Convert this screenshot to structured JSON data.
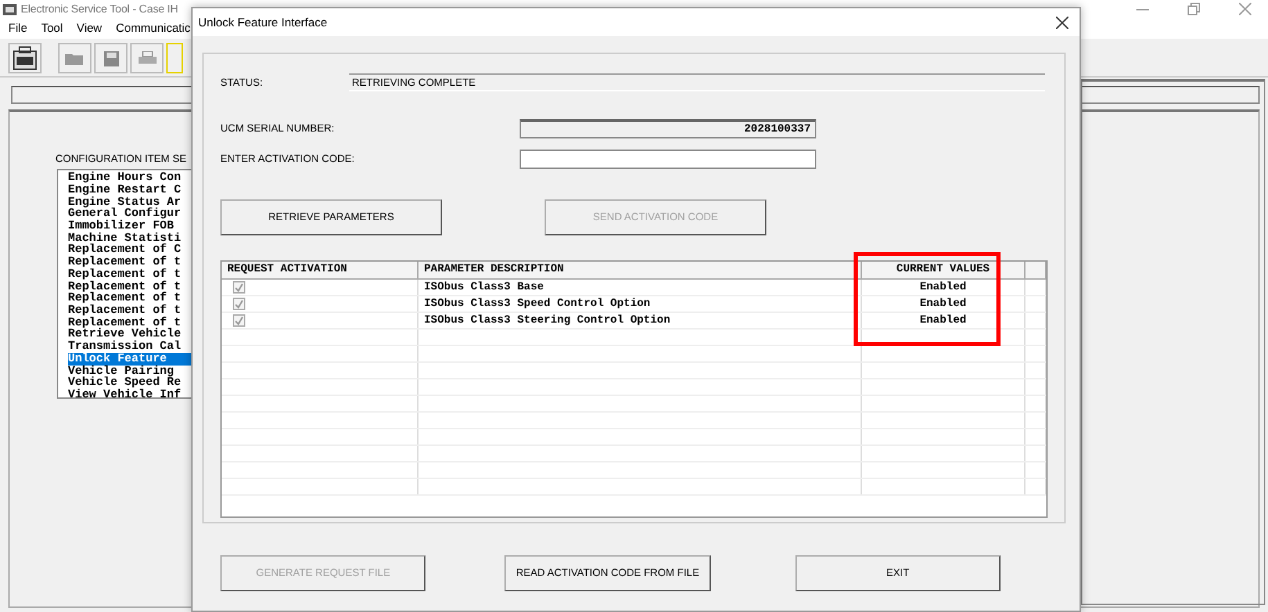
{
  "app_window": {
    "title": "Electronic Service Tool - Case IH",
    "menu": [
      "File",
      "Tool",
      "View",
      "Communicatic"
    ],
    "config_label": "CONFIGURATION ITEM SE",
    "config_items": [
      {
        "label": "Engine Hours Con",
        "selected": false
      },
      {
        "label": "Engine Restart C",
        "selected": false
      },
      {
        "label": "Engine Status Ar",
        "selected": false
      },
      {
        "label": "General Configur",
        "selected": false
      },
      {
        "label": "Immobilizer FOB",
        "selected": false
      },
      {
        "label": "Machine Statisti",
        "selected": false
      },
      {
        "label": "Replacement of C",
        "selected": false
      },
      {
        "label": "Replacement of t",
        "selected": false
      },
      {
        "label": "Replacement of t",
        "selected": false
      },
      {
        "label": "Replacement of t",
        "selected": false
      },
      {
        "label": "Replacement of t",
        "selected": false
      },
      {
        "label": "Replacement of t",
        "selected": false
      },
      {
        "label": "Replacement of t",
        "selected": false
      },
      {
        "label": "Retrieve Vehicle",
        "selected": false
      },
      {
        "label": "Transmission Cal",
        "selected": false
      },
      {
        "label": "Unlock Feature",
        "selected": true
      },
      {
        "label": "Vehicle Pairing",
        "selected": false
      },
      {
        "label": "Vehicle Speed Re",
        "selected": false
      },
      {
        "label": "View Vehicle Inf",
        "selected": false
      }
    ]
  },
  "dialog": {
    "title": "Unlock Feature Interface",
    "status_label": "STATUS:",
    "status_value": "RETRIEVING COMPLETE",
    "serial_label": "UCM SERIAL NUMBER:",
    "serial_value": "2028100337",
    "code_label": "ENTER ACTIVATION CODE:",
    "top_buttons": [
      {
        "label": "RETRIEVE PARAMETERS",
        "disabled": false
      },
      {
        "label": "SEND ACTIVATION CODE",
        "disabled": true
      }
    ],
    "table": {
      "columns": [
        "REQUEST ACTIVATION",
        "PARAMETER DESCRIPTION",
        "CURRENT VALUES"
      ],
      "rows": [
        {
          "checked": true,
          "description": "ISObus Class3 Base",
          "current_value": "Enabled"
        },
        {
          "checked": true,
          "description": "ISObus Class3 Speed Control Option",
          "current_value": "Enabled"
        },
        {
          "checked": true,
          "description": "ISObus Class3 Steering Control Option",
          "current_value": "Enabled"
        }
      ]
    },
    "bottom_buttons": [
      {
        "label": "GENERATE REQUEST FILE",
        "disabled": true
      },
      {
        "label": "READ ACTIVATION CODE FROM FILE",
        "disabled": false
      },
      {
        "label": "EXIT",
        "disabled": false
      }
    ]
  }
}
